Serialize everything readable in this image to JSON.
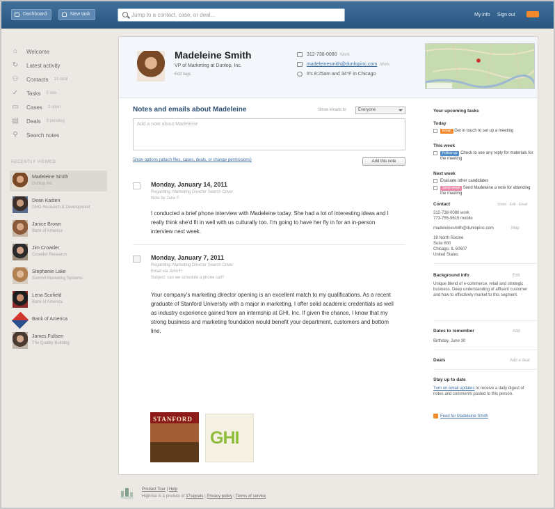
{
  "topbar": {
    "btn1_label": "Dashboard",
    "btn2_label": "New task",
    "search_placeholder": "Jump to a contact, case, or deal...",
    "my_info": "My info",
    "sign_out": "Sign out"
  },
  "sidebar": {
    "nav": [
      {
        "label": "Welcome",
        "count": ""
      },
      {
        "label": "Latest activity",
        "count": ""
      },
      {
        "label": "Contacts",
        "count": "14 total"
      },
      {
        "label": "Tasks",
        "count": "5 late"
      },
      {
        "label": "Cases",
        "count": "2 open"
      },
      {
        "label": "Deals",
        "count": "3 pending"
      },
      {
        "label": "Search notes",
        "count": ""
      }
    ],
    "recent_heading": "RECENTLY VIEWED",
    "recent": [
      {
        "name": "Madeleine Smith",
        "sub": "Dunlop Inc."
      },
      {
        "name": "Dean Kasten",
        "sub": "GHG Research & Development"
      },
      {
        "name": "Janice Brown",
        "sub": "Bank of America"
      },
      {
        "name": "Jim Crowder",
        "sub": "Crowder Research"
      },
      {
        "name": "Stephanie Lake",
        "sub": "Summit Marketing Systems"
      },
      {
        "name": "Lena Scofield",
        "sub": "Bank of America"
      },
      {
        "name": "Bank of America",
        "sub": ""
      },
      {
        "name": "James Fullsen",
        "sub": "The Quality Building"
      }
    ]
  },
  "profile": {
    "name": "Madeleine Smith",
    "title": "VP of Marketing at Dunlop, Inc.",
    "edit": "Edit tags",
    "phone": "312-738-0080",
    "phone_type": "Work",
    "email": "madeleinesmith@dunlopinc.com",
    "email_type": "Work",
    "time": "It's 8:25am and 34°F in Chicago"
  },
  "notes": {
    "title": "Notes and emails about Madeleine",
    "show_label": "Show emails to",
    "show_value": "Everyone",
    "placeholder": "Add a note about Madeleine",
    "attach_link": "Show options (attach files, cases, deals, or change permissions)",
    "add_button": "Add this note"
  },
  "entries": [
    {
      "date": "Monday, January 14, 2011",
      "meta1": "Regarding: Marketing Director Search Cover",
      "meta2": "Note by Jane F.",
      "body": "I conducted a brief phone interview with Madeleine today. She had a lot of interesting ideas and I really think she'd fit in well with us culturally too. I'm going to have her fly in for an in-person interview next week."
    },
    {
      "date": "Monday, January 7, 2011",
      "meta1": "Regarding: Marketing Director Search Cover",
      "meta2": "Email via John F.",
      "meta3": "Subject: can we schedule a phone call?",
      "body": "Your company's marketing director opening is an excellent match to my qualifications. As a recent graduate of Stanford University with a major in marketing, I offer solid academic credentials as well as industry experience gained from an internship at GHI, Inc. If given the chance, I know that my strong business and marketing foundation would benefit your department, customers and bottom line."
    }
  ],
  "images": {
    "stanford": "STANFORD",
    "ghi": "GHI"
  },
  "right": {
    "tasks_heading": "Your upcoming tasks",
    "today": "Today",
    "today_tag": "Email",
    "today_task": "Get in touch to set up a meeting",
    "this_week": "This week",
    "week_tag": "Follow up",
    "week_task": "Check to see any reply for materials for the meeting",
    "next_week": "Next week",
    "next_task1": "Evaluate other candidates",
    "next_tag": "Send email",
    "next_task2": "Send Madeleine a note for attending the meeting",
    "contact_heading": "Contact",
    "contact_actions": "Share · Edit · Email",
    "contact_phone1": "312-738-0080 work",
    "contact_phone2": "773-755-9615 mobile",
    "contact_email": "madeleinesmith@dunlopinc.com",
    "contact_addr1": "18 North Racine",
    "contact_addr2": "Suite 600",
    "contact_addr3": "Chicago, IL 60607",
    "contact_addr4": "United States",
    "contact_map": "Map",
    "bg_heading": "Background info",
    "bg_edit": "Edit",
    "bg_text": "Unique blend of e-commerce, retail and strategic business. Deep understanding of affluent customer and how to effectively market to this segment.",
    "dates_heading": "Dates to remember",
    "dates_edit": "Add",
    "dates_text": "Birthday, June 30",
    "deals_heading": "Deals",
    "deals_add": "Add a deal",
    "stay_heading": "Stay up to date",
    "stay_text_link": "Turn on email updates",
    "stay_text": "to receive a daily digest of notes and comments posted to this person.",
    "feed_link": "Feed for Madeleine Smith"
  },
  "footer": {
    "line1_a": "Product Tour",
    "line1_b": "Help",
    "line2_a": "Highrise is a product of",
    "line2_link": "37signals",
    "line2_b": "Privacy policy",
    "line2_c": "Terms of service"
  }
}
